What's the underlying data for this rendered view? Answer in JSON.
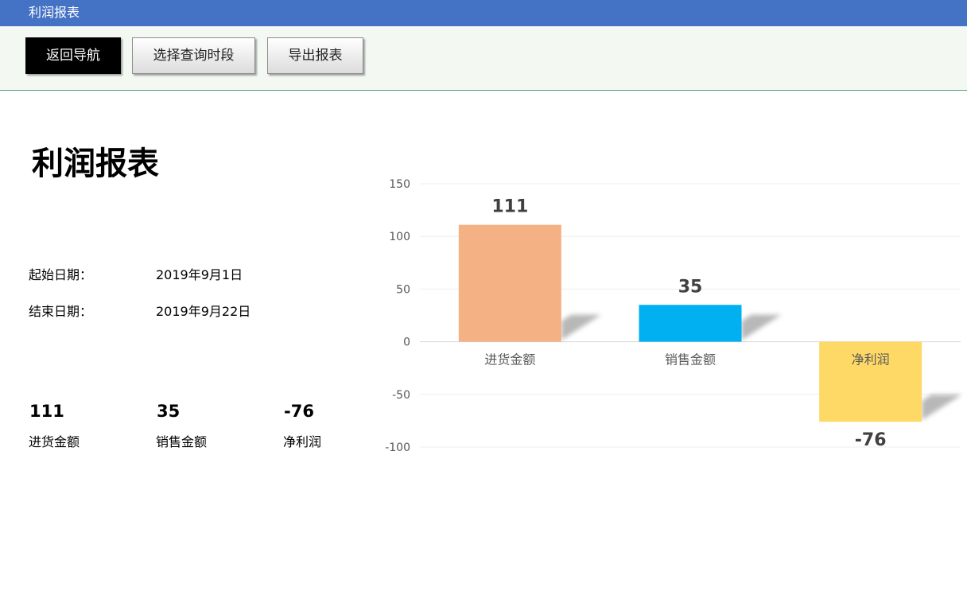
{
  "window": {
    "title": "利润报表"
  },
  "toolbar": {
    "back_label": "返回导航",
    "period_label": "选择查询时段",
    "export_label": "导出报表"
  },
  "report": {
    "title": "利润报表",
    "start_label": "起始日期：",
    "start_value": "2019年9月1日",
    "end_label": "结束日期：",
    "end_value": "2019年9月22日"
  },
  "summary": [
    {
      "value": "111",
      "label": "进货金额"
    },
    {
      "value": "35",
      "label": "销售金额"
    },
    {
      "value": "-76",
      "label": "净利润"
    }
  ],
  "colors": {
    "titlebar": "#4472c4",
    "purchase": "#f4b183",
    "sales": "#00b0f0",
    "profit": "#ffd966"
  },
  "chart_data": {
    "type": "bar",
    "categories": [
      "进货金额",
      "销售金额",
      "净利润"
    ],
    "values": [
      111,
      35,
      -76
    ],
    "ylim": [
      -100,
      150
    ],
    "yticks": [
      150,
      100,
      50,
      0,
      -50,
      -100
    ],
    "grid": true,
    "legend": "none"
  }
}
